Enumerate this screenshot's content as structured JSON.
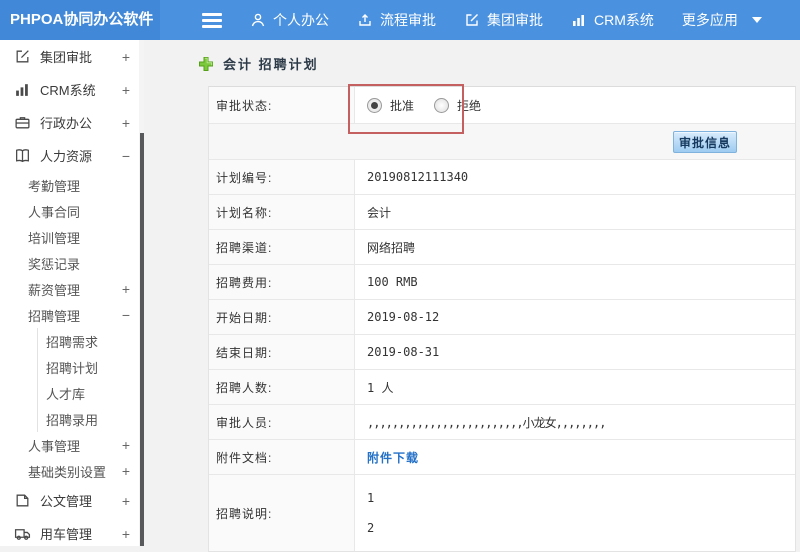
{
  "topbar": {
    "logo": "PHPOA协同办公软件",
    "nav": [
      {
        "label": "个人办公",
        "icon": "user-icon"
      },
      {
        "label": "流程审批",
        "icon": "process-icon"
      },
      {
        "label": "集团审批",
        "icon": "edit-icon"
      },
      {
        "label": "CRM系统",
        "icon": "chart-icon"
      },
      {
        "label": "更多应用",
        "icon": "caret-down-icon"
      }
    ]
  },
  "sidebar": {
    "items": [
      {
        "label": "集团审批",
        "icon": "edit-icon",
        "toggle": "+",
        "level": 1
      },
      {
        "label": "CRM系统",
        "icon": "chart-icon",
        "toggle": "+",
        "level": 1
      },
      {
        "label": "行政办公",
        "icon": "briefcase-icon",
        "toggle": "+",
        "level": 1
      },
      {
        "label": "人力资源",
        "icon": "book-icon",
        "toggle": "−",
        "level": 1
      },
      {
        "label": "考勤管理",
        "level": 2
      },
      {
        "label": "人事合同",
        "level": 2
      },
      {
        "label": "培训管理",
        "level": 2
      },
      {
        "label": "奖惩记录",
        "level": 2
      },
      {
        "label": "薪资管理",
        "toggle": "+",
        "level": 2
      },
      {
        "label": "招聘管理",
        "toggle": "−",
        "level": 2
      },
      {
        "label": "招聘需求",
        "level": 3
      },
      {
        "label": "招聘计划",
        "level": 3
      },
      {
        "label": "人才库",
        "level": 3
      },
      {
        "label": "招聘录用",
        "level": 3
      },
      {
        "label": "人事管理",
        "toggle": "+",
        "level": 2
      },
      {
        "label": "基础类别设置",
        "toggle": "+",
        "level": 2
      },
      {
        "label": "公文管理",
        "icon": "doc-icon",
        "toggle": "+",
        "level": 1
      },
      {
        "label": "用车管理",
        "icon": "truck-icon",
        "toggle": "+",
        "level": 1
      }
    ]
  },
  "main": {
    "title": "会计 招聘计划",
    "approval": {
      "label": "审批状态:",
      "options": [
        {
          "label": "批准",
          "selected": true
        },
        {
          "label": "拒绝",
          "selected": false
        }
      ]
    },
    "button_label": "审批信息",
    "rows": [
      {
        "label": "计划编号:",
        "value": "20190812111340"
      },
      {
        "label": "计划名称:",
        "value": "会计"
      },
      {
        "label": "招聘渠道:",
        "value": "网络招聘"
      },
      {
        "label": "招聘费用:",
        "value": "100 RMB"
      },
      {
        "label": "开始日期:",
        "value": "2019-08-12"
      },
      {
        "label": "结束日期:",
        "value": "2019-08-31"
      },
      {
        "label": "招聘人数:",
        "value": "1 人"
      },
      {
        "label": "审批人员:",
        "value": ",,,,,,,,,,,,,,,,,,,,,,,,,小龙女,,,,,,,,"
      },
      {
        "label": "附件文档:",
        "value": "附件下载",
        "link": true
      },
      {
        "label": "招聘说明:",
        "lines": [
          "1",
          "2"
        ]
      }
    ]
  },
  "colors": {
    "topbar_blue": "#4a92e0",
    "logo_blue": "#4189d8",
    "plus_green": "#6db33f",
    "annotation_red": "#c4605f",
    "link_blue": "#2471c8",
    "button_blue": "#9ecbf1"
  }
}
